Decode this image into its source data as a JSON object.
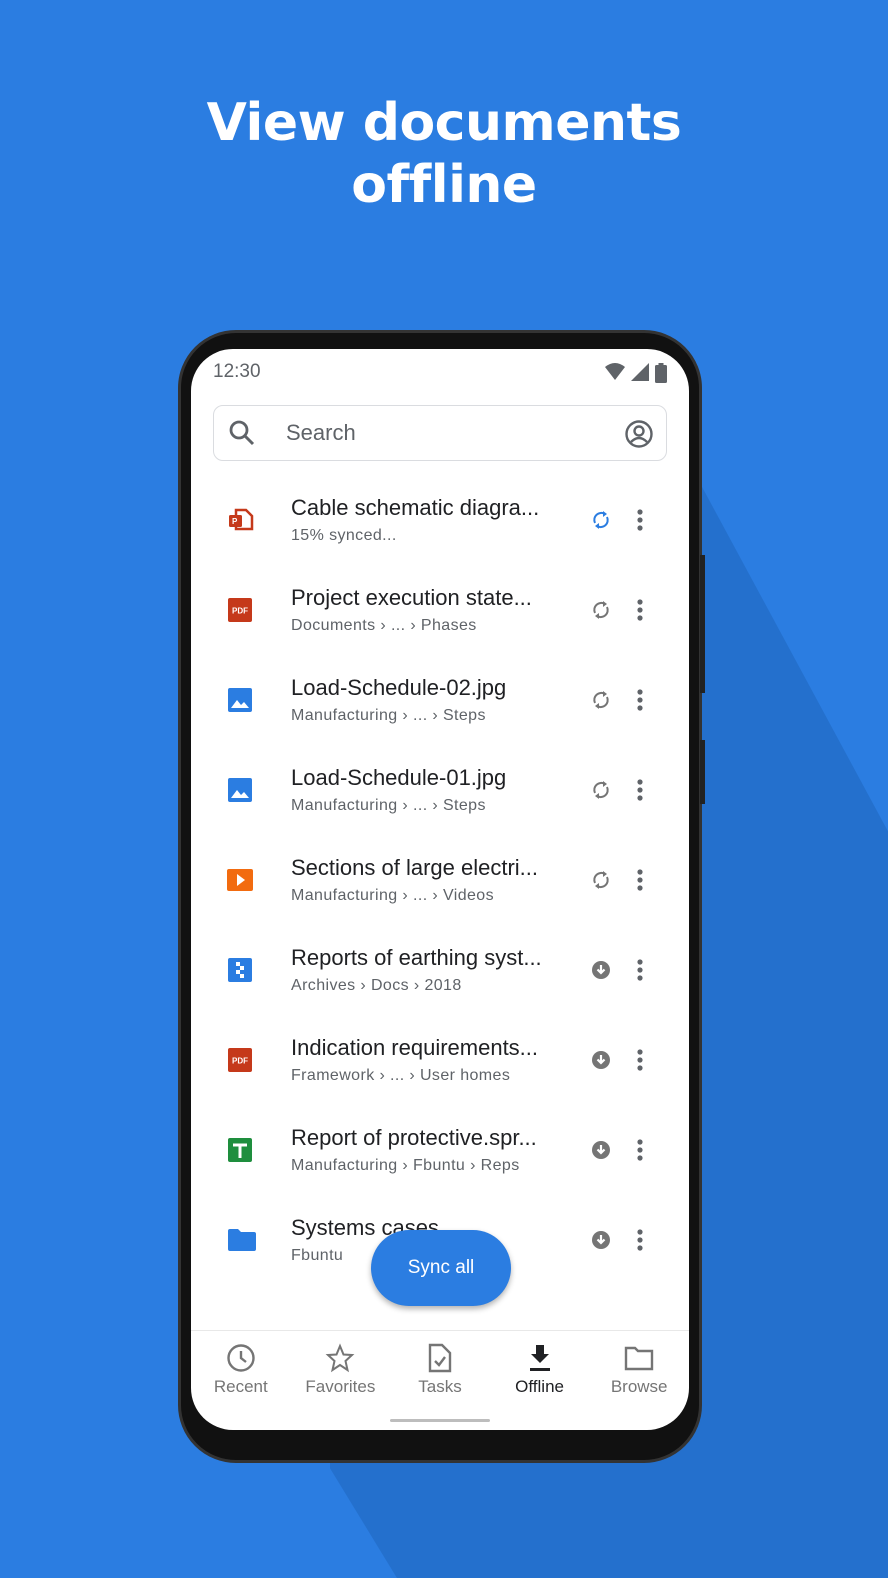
{
  "headline": [
    "View documents",
    "offline"
  ],
  "status": {
    "time": "12:30"
  },
  "search": {
    "placeholder": "Search"
  },
  "files": [
    {
      "title": "Cable schematic diagra...",
      "subtitle": "15% synced...",
      "type": "slides",
      "status": "syncing"
    },
    {
      "title": "Project execution state...",
      "subtitle": "Documents › ... › Phases",
      "type": "pdf",
      "status": "sync"
    },
    {
      "title": "Load-Schedule-02.jpg",
      "subtitle": "Manufacturing › ... › Steps",
      "type": "image",
      "status": "sync"
    },
    {
      "title": "Load-Schedule-01.jpg",
      "subtitle": "Manufacturing › ... › Steps",
      "type": "image",
      "status": "sync"
    },
    {
      "title": "Sections of large electri...",
      "subtitle": "Manufacturing › ... › Videos",
      "type": "video",
      "status": "sync"
    },
    {
      "title": "Reports of earthing syst...",
      "subtitle": "Archives › Docs › 2018",
      "type": "archive",
      "status": "downloaded"
    },
    {
      "title": "Indication requirements...",
      "subtitle": "Framework › ... › User homes",
      "type": "pdf",
      "status": "downloaded"
    },
    {
      "title": "Report of protective.spr...",
      "subtitle": "Manufacturing › Fbuntu › Reps",
      "type": "sheet",
      "status": "downloaded"
    },
    {
      "title": "Systems cases",
      "subtitle": "Fbuntu",
      "type": "folder",
      "status": "downloaded"
    }
  ],
  "fab": "Sync all",
  "nav": [
    {
      "label": "Recent",
      "icon": "clock-icon"
    },
    {
      "label": "Favorites",
      "icon": "star-icon"
    },
    {
      "label": "Tasks",
      "icon": "task-icon"
    },
    {
      "label": "Offline",
      "icon": "download-icon",
      "active": true
    },
    {
      "label": "Browse",
      "icon": "folder-icon"
    }
  ],
  "colors": {
    "background": "#2b7de1",
    "accent": "#2b7de1",
    "pdf": "#c5391a",
    "image": "#2b7de1",
    "video": "#f26b0f",
    "sheet": "#1e8e3e"
  }
}
